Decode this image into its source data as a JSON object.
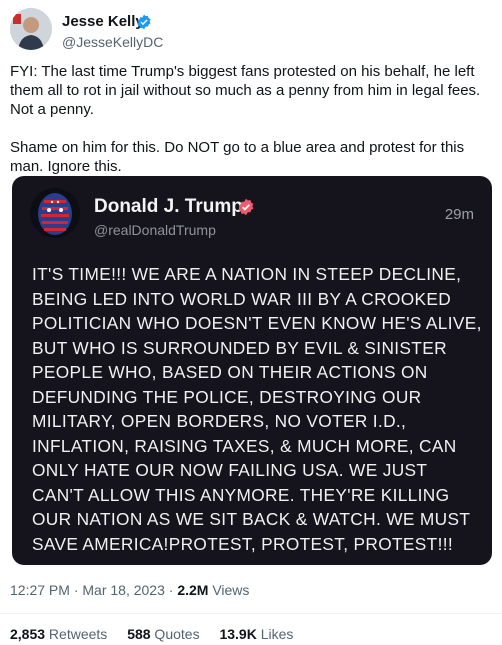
{
  "author": {
    "name": "Jesse Kelly",
    "handle": "@JesseKellyDC",
    "verified_icon": "verified-badge-icon",
    "avatar_icon": "avatar-photo"
  },
  "tweet": {
    "text": "FYI: The last time Trump's biggest fans protested on his behalf, he left them all to rot in jail without so much as a penny from him in legal fees. Not a penny.\n\nShame on him for this. Do NOT go to a blue area and protest for this man. Ignore this."
  },
  "quoted_post": {
    "name": "Donald J. Trump",
    "handle": "@realDonaldTrump",
    "time": "29m",
    "verified_icon": "verified-badge-icon",
    "verified_color": "#ef5a6f",
    "body": "IT'S TIME!!! WE ARE A NATION IN STEEP DECLINE, BEING LED INTO WORLD WAR III BY A CROOKED POLITICIAN WHO DOESN'T EVEN KNOW HE'S ALIVE, BUT WHO IS SURROUNDED BY EVIL & SINISTER PEOPLE WHO, BASED ON THEIR ACTIONS ON DEFUNDING THE POLICE, DESTROYING OUR MILITARY, OPEN BORDERS, NO VOTER I.D., INFLATION, RAISING TAXES, & MUCH MORE, CAN ONLY HATE OUR NOW FAILING USA. WE JUST CAN'T ALLOW THIS ANYMORE. THEY'RE KILLING OUR NATION AS WE SIT BACK & WATCH. WE MUST SAVE AMERICA!PROTEST, PROTEST, PROTEST!!!"
  },
  "meta": {
    "timestamp": "12:27 PM · Mar 18, 2023 · ",
    "views_count": "2.2M",
    "views_label": " Views"
  },
  "stats": {
    "retweets_count": "2,853",
    "retweets_label": " Retweets",
    "quotes_count": "588",
    "quotes_label": " Quotes",
    "likes_count": "13.9K",
    "likes_label": " Likes"
  },
  "colors": {
    "verified_blue": "#1d9bf0",
    "card_bg": "#15141c",
    "muted": "#536471"
  }
}
